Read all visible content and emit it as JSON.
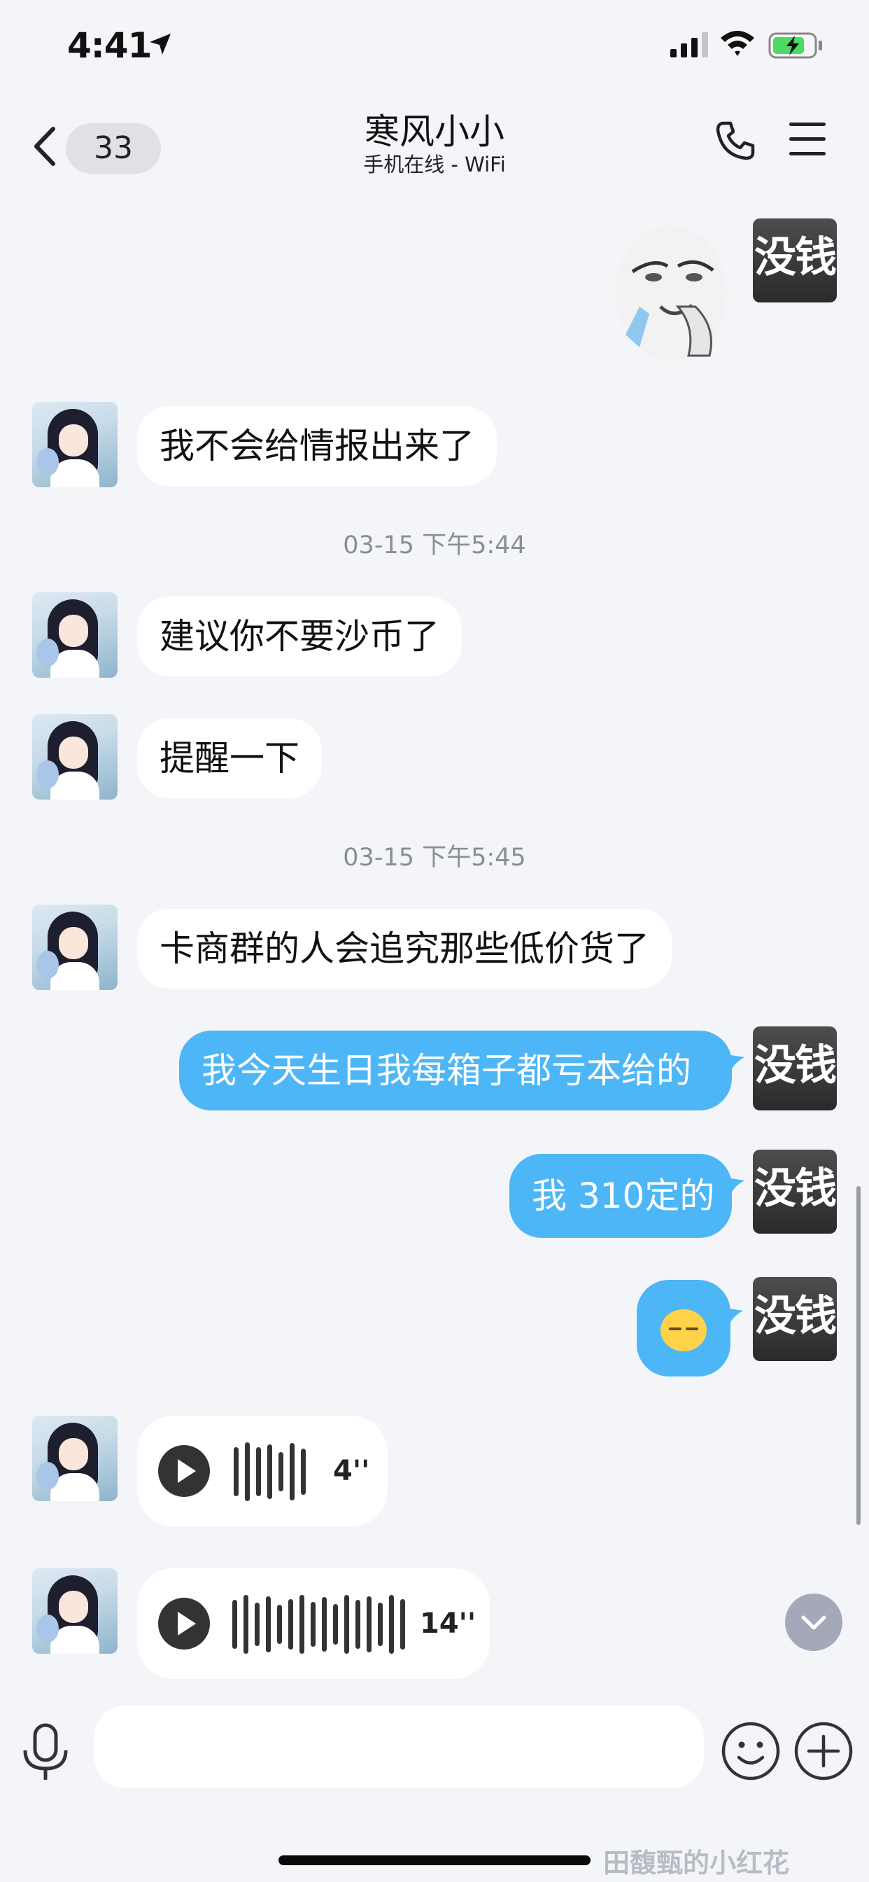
{
  "status_bar": {
    "time": "4:41"
  },
  "header": {
    "unread_count": "33",
    "title": "寒风小小",
    "subtitle": "手机在线 - WiFi"
  },
  "my_avatar_text": "没钱",
  "messages": [
    {
      "from": "other",
      "text": "我不会给情报出来了"
    },
    {
      "timestamp": "03-15 下午5:44"
    },
    {
      "from": "other",
      "text": "建议你不要沙币了"
    },
    {
      "from": "other",
      "text": "提醒一下"
    },
    {
      "timestamp": "03-15 下午5:45"
    },
    {
      "from": "other",
      "text": "卡商群的人会追究那些低价货了"
    },
    {
      "from": "me",
      "text": "我今天生日我每箱子都亏本给的"
    },
    {
      "from": "me",
      "text": "我 310定的"
    },
    {
      "from": "me",
      "emoji": "😑"
    },
    {
      "from": "other",
      "voice_duration": "4''"
    },
    {
      "from": "other",
      "voice_duration": "14''"
    }
  ],
  "watermark": "田馥甄的小红花",
  "colors": {
    "outgoing_bubble": "#4db6f6",
    "background": "#f4f5f9"
  },
  "icons": [
    "location-arrow-icon",
    "signal-icon",
    "wifi-icon",
    "battery-charging-icon",
    "chevron-left-icon",
    "phone-icon",
    "menu-icon",
    "microphone-icon",
    "smile-icon",
    "plus-icon",
    "chevron-down-icon",
    "play-icon"
  ]
}
